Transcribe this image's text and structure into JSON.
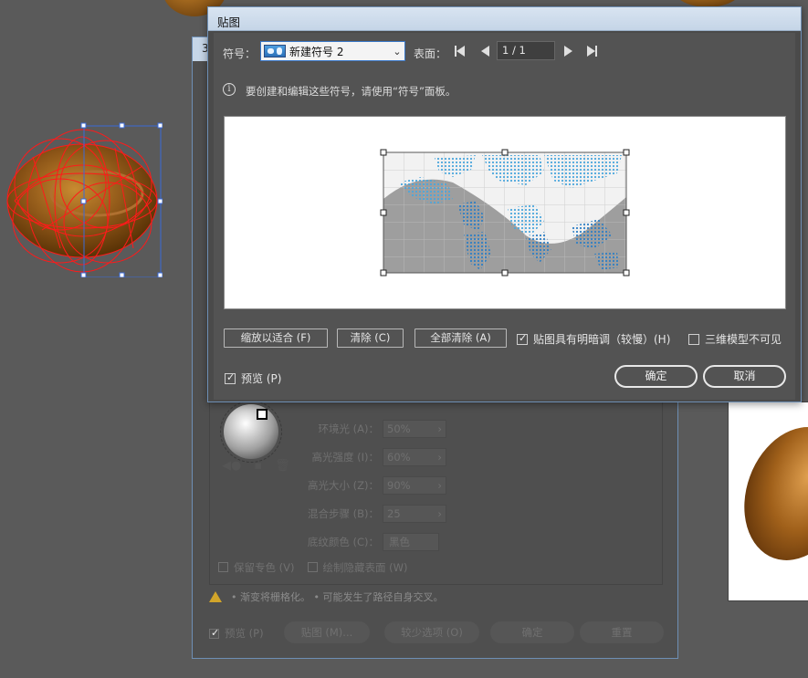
{
  "dialog": {
    "title": "贴图",
    "symbol_label": "符号：",
    "symbol_value": "新建符号 2",
    "surface_label": "表面：",
    "page_value": "1 / 1",
    "info_text": "要创建和编辑这些符号，请使用“符号”面板。",
    "buttons": {
      "scale_to_fit": "缩放以适合 (F)",
      "clear": "清除 (C)",
      "clear_all": "全部清除 (A)",
      "ok": "确定",
      "cancel": "取消"
    },
    "checkboxes": {
      "shade_artwork": {
        "label": "贴图具有明暗调（较慢）(H)",
        "checked": true
      },
      "invisible_geometry": {
        "label": "三维模型不可见",
        "checked": false
      },
      "preview": {
        "label": "预览 (P)",
        "checked": true
      }
    }
  },
  "background_dialog": {
    "settings": [
      {
        "label": "环境光 (A)：",
        "value": "50%"
      },
      {
        "label": "高光强度 (I)：",
        "value": "60%"
      },
      {
        "label": "高光大小 (Z)：",
        "value": "90%"
      },
      {
        "label": "混合步骤 (B)：",
        "value": "25"
      }
    ],
    "shade_color_label": "底纹颜色 (C)：",
    "shade_color_value": "黑色",
    "preserve_spot_label": "保留专色 (V)",
    "draw_hidden_label": "绘制隐藏表面 (W)",
    "warning_text": "• 渐变将栅格化。 • 可能发生了路径自身交叉。",
    "footer": {
      "preview": "预览 (P)",
      "map_art": "贴图 (M)...",
      "fewer_options": "较少选项 (O)",
      "ok": "确定",
      "reset": "重置"
    }
  },
  "colors": {
    "accent_blue": "#3a78c8",
    "selection_red": "#ff0000",
    "map_dots": "#4aa6dc"
  }
}
